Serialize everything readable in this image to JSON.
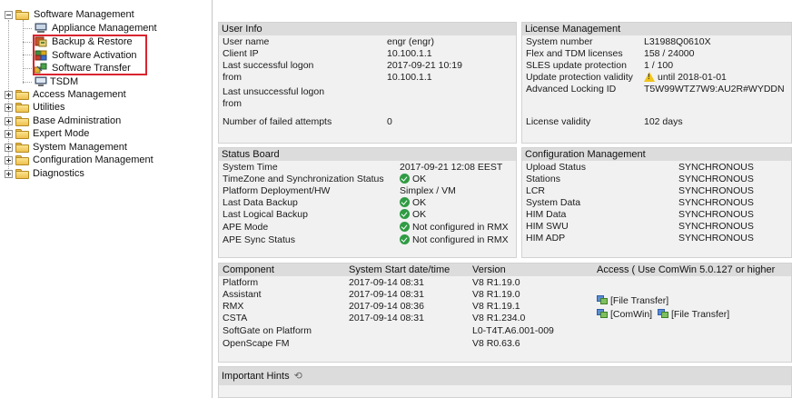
{
  "tree": {
    "items": [
      {
        "label": "Software Management",
        "expanded": true
      },
      {
        "label": "Appliance Management"
      },
      {
        "label": "Backup & Restore"
      },
      {
        "label": "Software Activation"
      },
      {
        "label": "Software Transfer"
      },
      {
        "label": "TSDM"
      },
      {
        "label": "Access Management"
      },
      {
        "label": "Utilities"
      },
      {
        "label": "Base Administration"
      },
      {
        "label": "Expert Mode"
      },
      {
        "label": "System Management"
      },
      {
        "label": "Configuration Management"
      },
      {
        "label": "Diagnostics"
      }
    ]
  },
  "user_info": {
    "title": "User Info",
    "rows": [
      {
        "label": "User name",
        "value": "engr (engr)"
      },
      {
        "label": "Client IP",
        "value": "10.100.1.1"
      },
      {
        "label": "Last successful logon",
        "value": "2017-09-21 10:19"
      },
      {
        "label": "from",
        "value": "10.100.1.1"
      },
      {
        "label": "Last unsuccessful logon",
        "value": ""
      },
      {
        "label": "from",
        "value": ""
      },
      {
        "label": "Number of failed attempts",
        "value": "0"
      }
    ]
  },
  "license": {
    "title": "License Management",
    "rows": [
      {
        "label": "System number",
        "value": "L31988Q0610X"
      },
      {
        "label": "Flex and TDM licenses",
        "value": "158 / 24000"
      },
      {
        "label": "SLES update protection",
        "value": "1 / 100"
      },
      {
        "label": "Update protection validity",
        "value": "until 2018-01-01"
      },
      {
        "label": "Advanced Locking ID",
        "value": "T5W99WTZ7W9:AU2R#WYDDN"
      },
      {
        "label": "License validity",
        "value": "102 days"
      }
    ]
  },
  "status_board": {
    "title": "Status Board",
    "rows": [
      {
        "label": "System Time",
        "value": "2017-09-21 12:08 EEST"
      },
      {
        "label": "TimeZone and Synchronization Status",
        "value": "OK"
      },
      {
        "label": "Platform Deployment/HW",
        "value": "Simplex / VM"
      },
      {
        "label": "Last Data Backup",
        "value": "OK"
      },
      {
        "label": "Last Logical Backup",
        "value": "OK"
      },
      {
        "label": "APE Mode",
        "value": "Not configured in RMX"
      },
      {
        "label": "APE Sync Status",
        "value": "Not configured in RMX"
      }
    ]
  },
  "config_mgmt": {
    "title": "Configuration Management",
    "rows": [
      {
        "label": "Upload Status",
        "value": "SYNCHRONOUS"
      },
      {
        "label": "Stations",
        "value": "SYNCHRONOUS"
      },
      {
        "label": "LCR",
        "value": "SYNCHRONOUS"
      },
      {
        "label": "System Data",
        "value": "SYNCHRONOUS"
      },
      {
        "label": "HIM Data",
        "value": "SYNCHRONOUS"
      },
      {
        "label": "HIM SWU",
        "value": "SYNCHRONOUS"
      },
      {
        "label": "HIM ADP",
        "value": "SYNCHRONOUS"
      }
    ]
  },
  "components": {
    "headers": {
      "component": "Component",
      "start": "System Start date/time",
      "version": "Version",
      "access": "Access ( Use ComWin 5.0.127 or higher"
    },
    "rows": [
      {
        "name": "Platform",
        "start": "2017-09-14 08:31",
        "version": "V8 R1.19.0"
      },
      {
        "name": "Assistant",
        "start": "2017-09-14 08:31",
        "version": "V8 R1.19.0"
      },
      {
        "name": "RMX",
        "start": "2017-09-14 08:36",
        "version": "V8 R1.19.1"
      },
      {
        "name": "CSTA",
        "start": "2017-09-14 08:31",
        "version": "V8 R1.234.0"
      },
      {
        "name": "SoftGate on Platform",
        "start": "",
        "version": "L0-T4T.A6.001-009"
      },
      {
        "name": "OpenScape FM",
        "start": "",
        "version": "V8 R0.63.6"
      }
    ],
    "access_links": {
      "assistant_file_transfer": "[File Transfer]",
      "rmx_comwin": "[ComWin]",
      "rmx_file_transfer": "[File Transfer]"
    }
  },
  "hints": {
    "title": "Important Hints",
    "refresh_glyph": "⟲"
  },
  "colors": {
    "highlight": "#d9242f",
    "ok": "#2f9b43",
    "warning": "#f0c419",
    "panel_title_bg": "#dcdcdc",
    "panel_bg": "#f1f1f1"
  }
}
